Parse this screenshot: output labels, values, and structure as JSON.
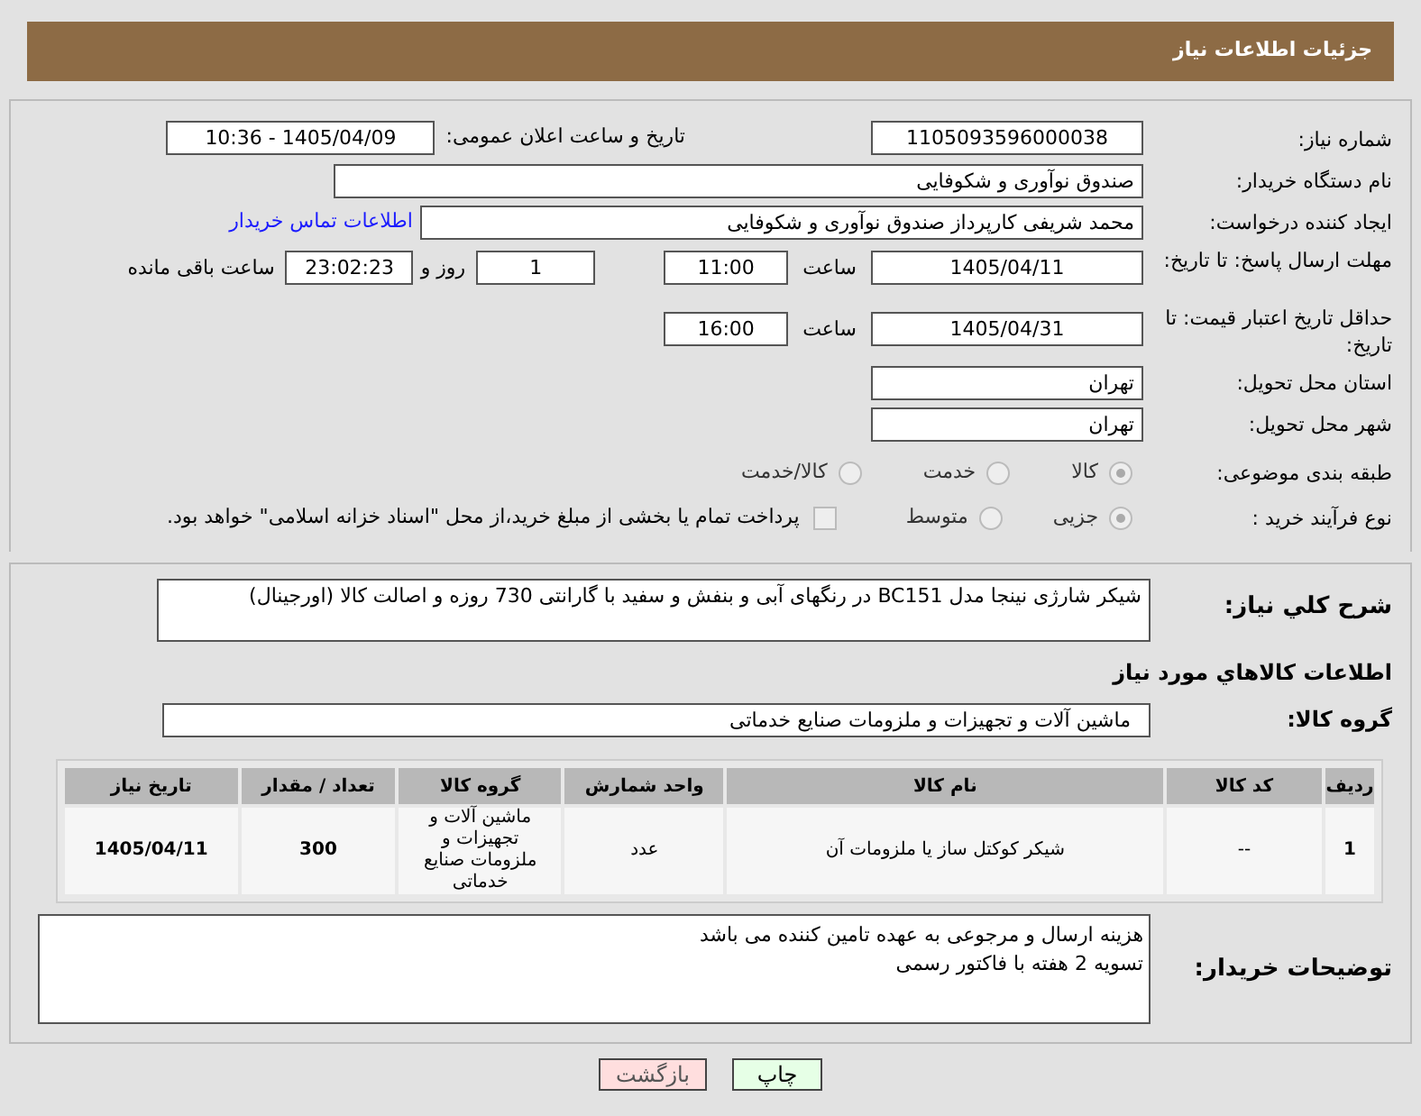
{
  "header": {
    "title": "جزئیات اطلاعات نیاز"
  },
  "need_number": {
    "label": "شماره نیاز:",
    "value": "1105093596000038"
  },
  "announce": {
    "label": "تاریخ و ساعت اعلان عمومی:",
    "value": "1405/04/09 - 10:36"
  },
  "buyer": {
    "label": "نام دستگاه خریدار:",
    "value": "صندوق نوآوری و شکوفایی"
  },
  "requester": {
    "label": "ایجاد کننده درخواست:",
    "value": "محمد  شریفی کارپرداز صندوق نوآوری و شکوفایی",
    "link": "اطلاعات تماس خریدار"
  },
  "response_deadline": {
    "label": "مهلت ارسال پاسخ: تا تاریخ:",
    "date": "1405/04/11",
    "time_label": "ساعت",
    "time": "11:00",
    "days": "1",
    "days_label": "روز و",
    "remaining": "23:02:23",
    "remaining_label": "ساعت باقی مانده"
  },
  "price_validity": {
    "label": "حداقل تاریخ اعتبار قیمت: تا تاریخ:",
    "date": "1405/04/31",
    "time_label": "ساعت",
    "time": "16:00"
  },
  "province": {
    "label": "استان محل تحویل:",
    "value": "تهران"
  },
  "city": {
    "label": "شهر محل تحویل:",
    "value": "تهران"
  },
  "category": {
    "label": "طبقه بندی موضوعی:",
    "options": [
      {
        "label": "کالا",
        "selected": true
      },
      {
        "label": "خدمت",
        "selected": false
      },
      {
        "label": "کالا/خدمت",
        "selected": false
      }
    ]
  },
  "process": {
    "label": "نوع فرآیند خرید :",
    "options": [
      {
        "label": "جزیی",
        "selected": true
      },
      {
        "label": "متوسط",
        "selected": false
      }
    ],
    "payment_note": {
      "label": "پرداخت تمام یا بخشی از مبلغ خرید،از محل \"اسناد خزانه اسلامی\" خواهد بود.",
      "checked": false
    }
  },
  "description": {
    "label": "شرح کلي نياز:",
    "value": "شیکر شارژی نینجا مدل BC151 در رنگهای آبی و بنفش و سفید با گارانتی 730 روزه و اصالت کالا (اورجینال)"
  },
  "goods_title": "اطلاعات کالاهاي مورد نياز",
  "goods_group": {
    "label": "گروه کالا:",
    "value": "ماشین آلات و تجهیزات و ملزومات صنایع خدماتی"
  },
  "table": {
    "columns": [
      "ردیف",
      "کد کالا",
      "نام کالا",
      "واحد شمارش",
      "گروه کالا",
      "تعداد / مقدار",
      "تاریخ نیاز"
    ],
    "rows": [
      [
        "1",
        "--",
        "شیکر کوکتل ساز یا ملزومات آن",
        "عدد",
        "ماشین آلات و تجهیزات و ملزومات صنایع خدماتی",
        "300",
        "1405/04/11"
      ]
    ]
  },
  "buyer_notes": {
    "label": "توضیحات خریدار:",
    "value": "هزینه ارسال و مرجوعی به عهده تامین کننده می باشد\nتسویه 2 هفته با فاکتور رسمی"
  },
  "buttons": [
    {
      "label": "چاپ",
      "kind": "print"
    },
    {
      "label": "بازگشت",
      "kind": "back"
    }
  ]
}
